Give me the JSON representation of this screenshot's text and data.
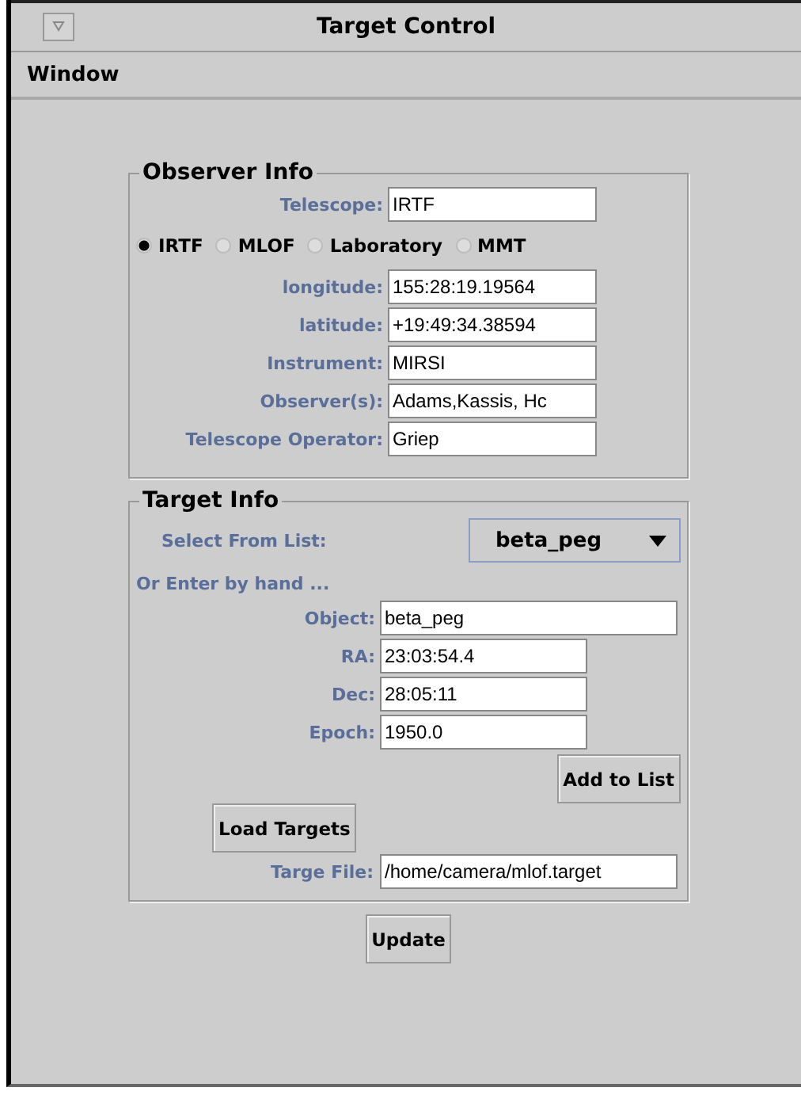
{
  "window": {
    "title": "Target Control"
  },
  "menu": [
    "Window"
  ],
  "observer_info": {
    "title": "Observer Info",
    "telescope": {
      "label": "Telescope:",
      "value": "IRTF"
    },
    "sites": [
      {
        "label": "IRTF",
        "selected": true
      },
      {
        "label": "MLOF",
        "selected": false
      },
      {
        "label": "Laboratory",
        "selected": false
      },
      {
        "label": "MMT",
        "selected": false
      }
    ],
    "fields": [
      {
        "label": "longitude:",
        "value": "155:28:19.19564"
      },
      {
        "label": "latitude:",
        "value": "+19:49:34.38594"
      },
      {
        "label": "Instrument:",
        "value": "MIRSI"
      },
      {
        "label": "Observer(s):",
        "value": "Adams,Kassis, Hc"
      },
      {
        "label": "Telescope Operator:",
        "value": "Griep"
      }
    ]
  },
  "target_info": {
    "title": "Target Info",
    "select_label": "Select From List:",
    "select_value": "beta_peg",
    "hint": "Or Enter by hand ...",
    "object": {
      "label": "Object:",
      "value": "beta_peg"
    },
    "fields": [
      {
        "label": "RA:",
        "value": "23:03:54.4"
      },
      {
        "label": "Dec:",
        "value": "28:05:11"
      },
      {
        "label": "Epoch:",
        "value": "1950.0"
      }
    ],
    "add_button": "Add to List",
    "load_button": "Load Targets",
    "file": {
      "label": "Targe File:",
      "value": "/home/camera/mlof.target"
    }
  },
  "update_button": "Update"
}
